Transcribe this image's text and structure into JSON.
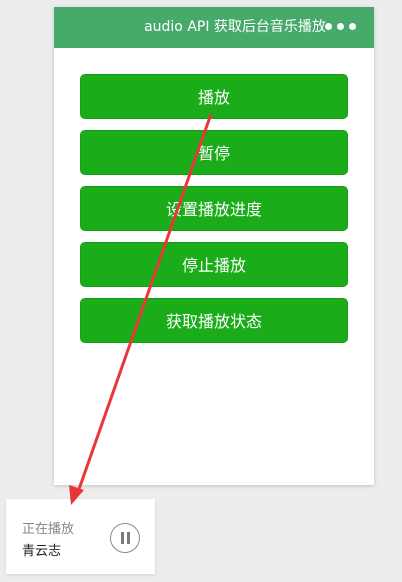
{
  "navbar": {
    "title": "audio API 获取后台音乐播放",
    "more_icon": "more-dots-icon"
  },
  "buttons": [
    {
      "label": "播放"
    },
    {
      "label": "暂停"
    },
    {
      "label": "设置播放进度"
    },
    {
      "label": "停止播放"
    },
    {
      "label": "获取播放状态"
    }
  ],
  "mini_player": {
    "status": "正在播放",
    "title": "青云志",
    "control_icon": "pause-icon"
  },
  "colors": {
    "navbar": "#46aa6b",
    "button": "#1aad19",
    "annotation_arrow": "#e8373a"
  }
}
